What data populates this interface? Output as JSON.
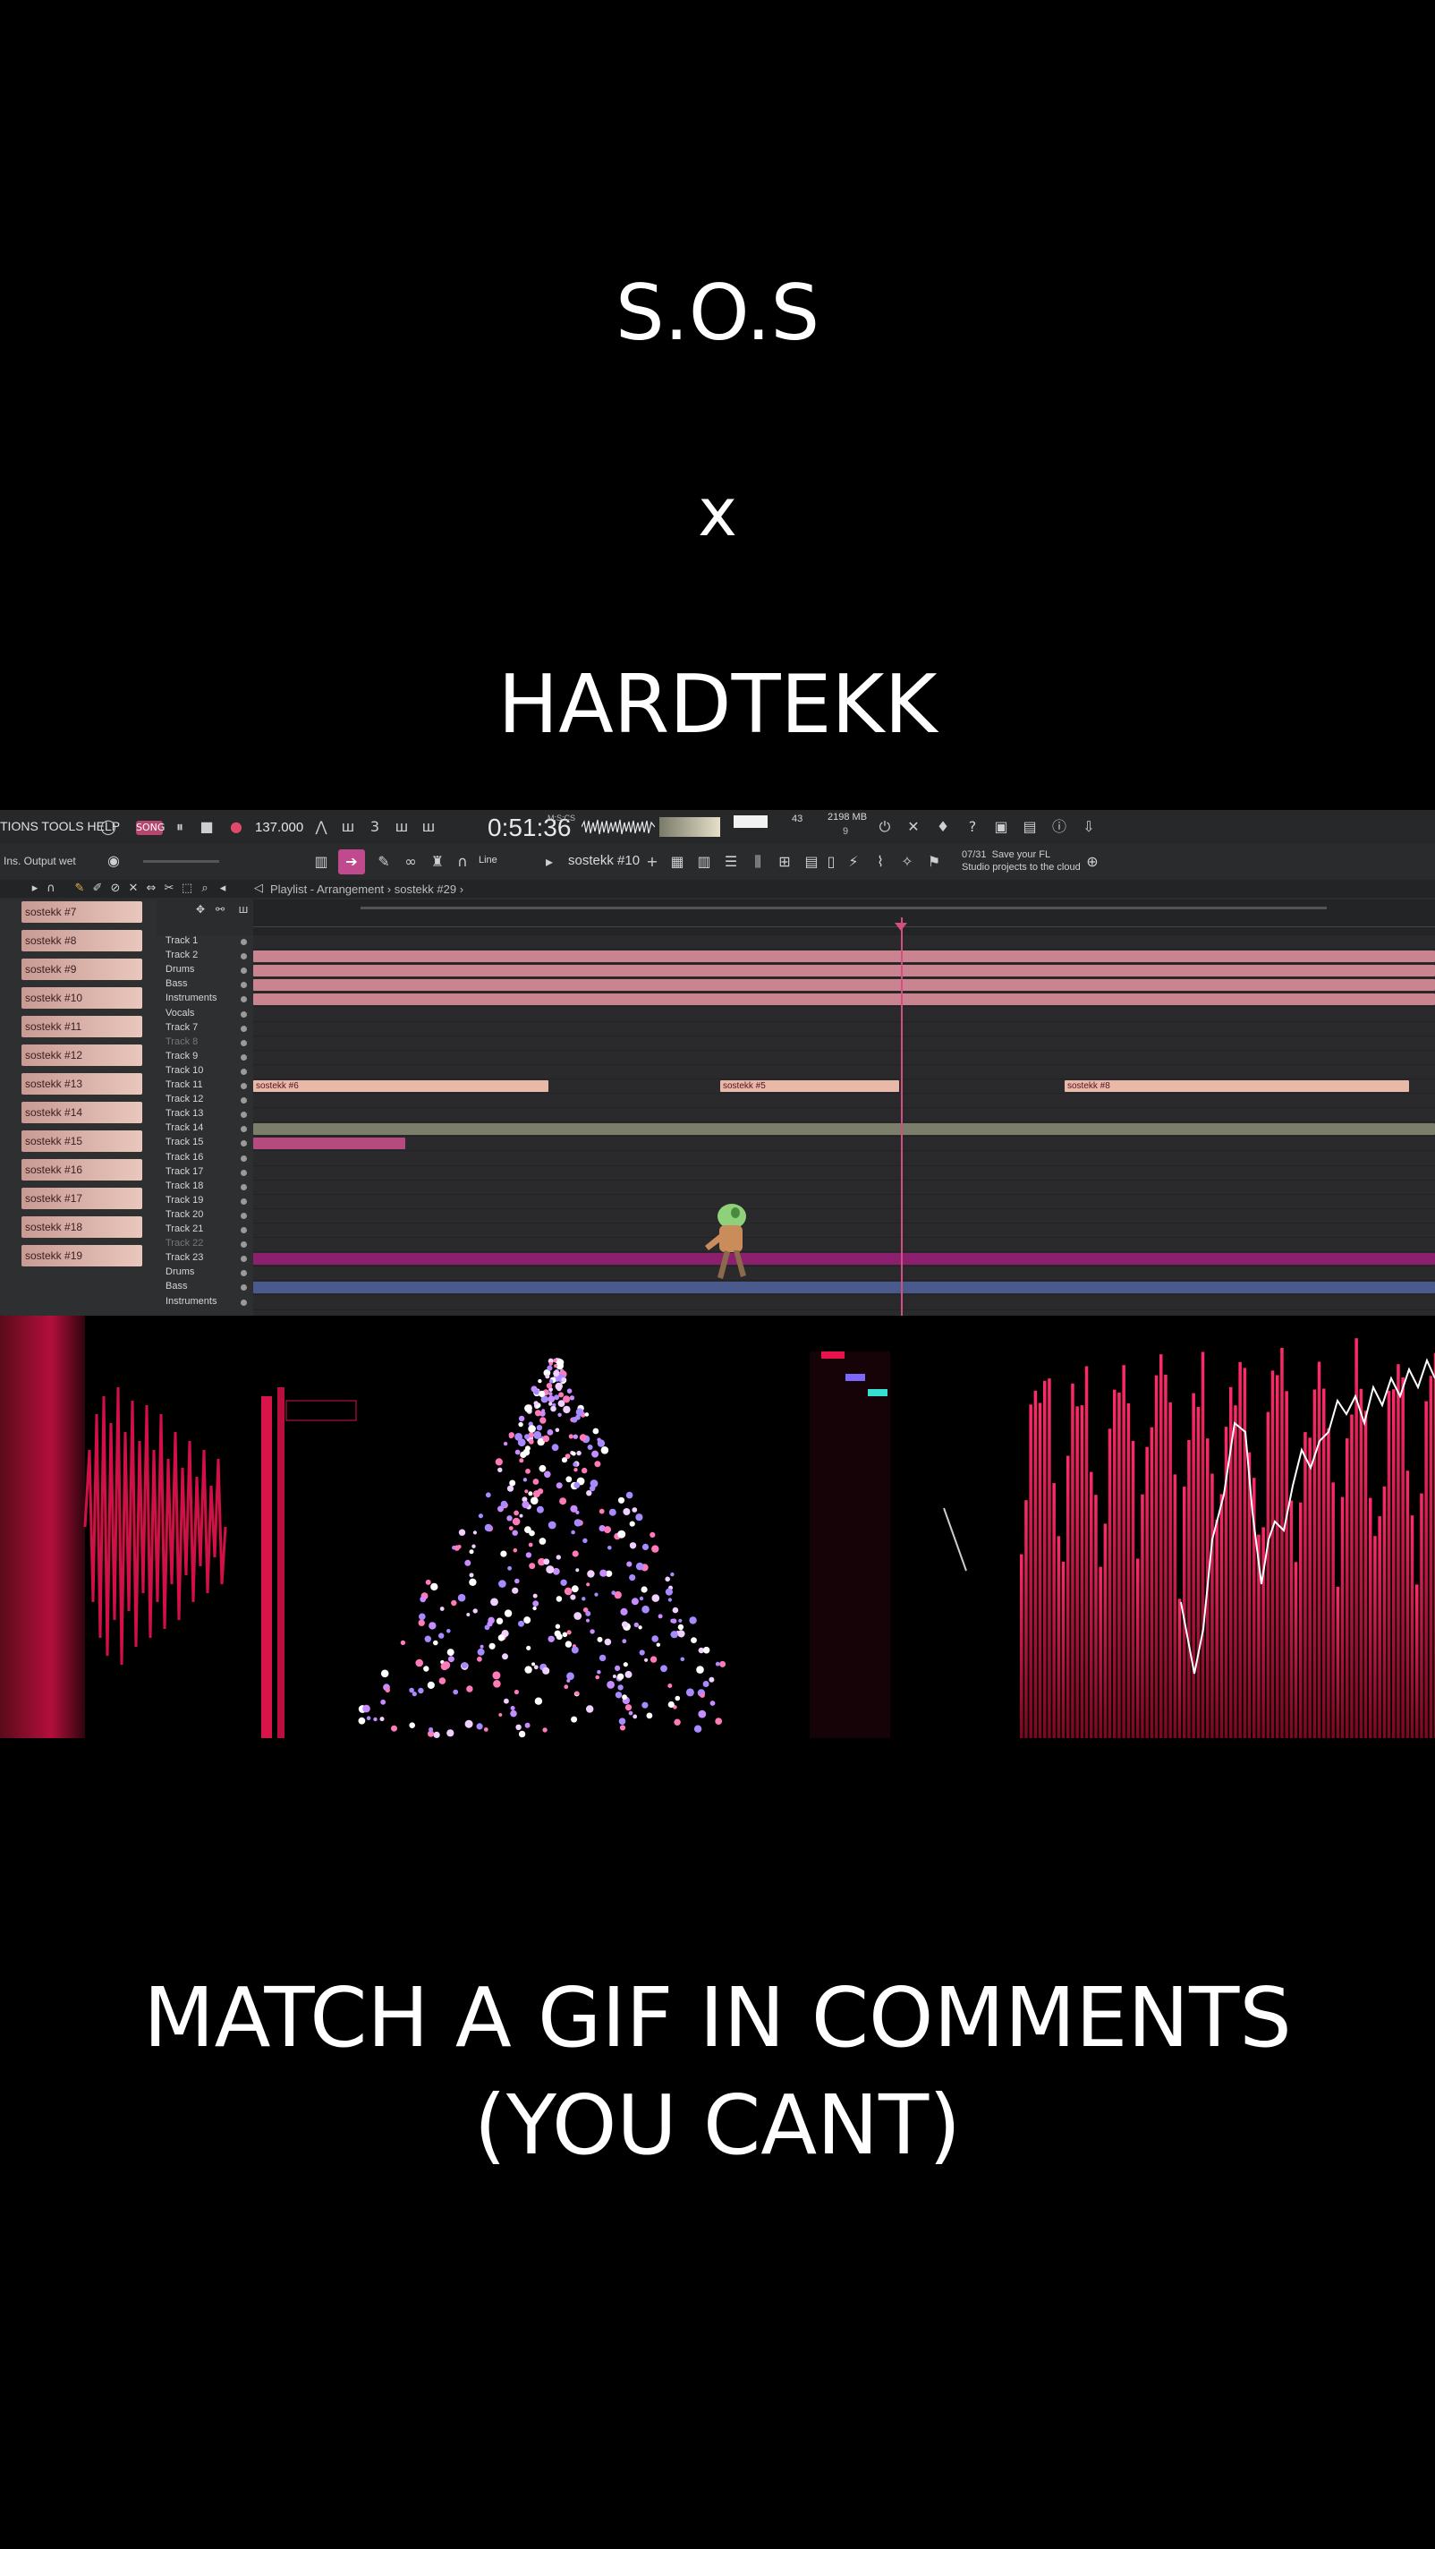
{
  "captions": {
    "line1": "S.O.S",
    "line2": "x",
    "line3": "HARDTEKK",
    "bottom_line1": "MATCH A GIF IN COMMENTS",
    "bottom_line2": "(YOU CANT)"
  },
  "fl": {
    "menu": "TIONS TOOLS HELP",
    "song_label": "SONG",
    "tempo": "137.000",
    "time": "0:51:36",
    "time_unit": "M:S:CS",
    "cpu": "43",
    "ram": "2198 MB",
    "ram2": "9",
    "output_label": "Ins. Output wet",
    "snap_label": "Line",
    "pattern": "sostekk #10",
    "cloud_hint_count": "07/31",
    "cloud_hint_text1": "Save your FL",
    "cloud_hint_text2": "Studio projects to the cloud",
    "breadcrumb": "Playlist - Arrangement › sostekk #29 ›",
    "rack": [
      "sostekk #7",
      "sostekk #8",
      "sostekk #9",
      "sostekk #10",
      "sostekk #11",
      "sostekk #12",
      "sostekk #13",
      "sostekk #14",
      "sostekk #15",
      "sostekk #16",
      "sostekk #17",
      "sostekk #18",
      "sostekk #19"
    ],
    "tracks": [
      "Track 1",
      "Track 2",
      "Drums",
      "Bass",
      "Instruments",
      "Vocals",
      "Track 7",
      "Track 8",
      "Track 9",
      "Track 10",
      "Track 11",
      "Track 12",
      "Track 13",
      "Track 14",
      "Track 15",
      "Track 16",
      "Track 17",
      "Track 18",
      "Track 19",
      "Track 20",
      "Track 21",
      "Track 22",
      "Track 23",
      "Drums",
      "Bass",
      "Instruments"
    ],
    "clip_labels": [
      "sostekk #6",
      "sostekk #5",
      "sostekk #8"
    ]
  },
  "colors": {
    "accent_pink": "#e0245e",
    "clip_pink": "#c9848f",
    "track_purple": "#8c1f6e",
    "track_blue": "#4a5a8c"
  }
}
